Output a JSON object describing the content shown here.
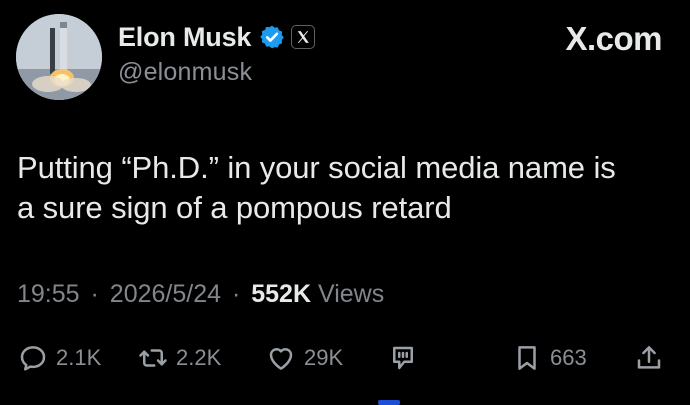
{
  "author": {
    "display_name": "Elon Musk",
    "handle": "@elonmusk",
    "verified": true,
    "affiliate_badge": "x-logo-icon"
  },
  "brand": {
    "site_label": "X.com"
  },
  "tweet": {
    "text_line_1": "Putting “Ph.D.” in your social media name is",
    "text_line_2": "a sure sign of a pompous retard"
  },
  "meta": {
    "time": "19:55",
    "separator": "·",
    "date": "2026/5/24",
    "views_count": "552K",
    "views_label": "Views"
  },
  "actions": {
    "replies": "2.1K",
    "reposts": "2.2K",
    "likes": "29K",
    "bookmarks": "663"
  },
  "colors": {
    "background": "#000000",
    "text_primary": "#e7e9ea",
    "text_secondary": "#8b9096",
    "verified_blue": "#1d9bf0"
  }
}
